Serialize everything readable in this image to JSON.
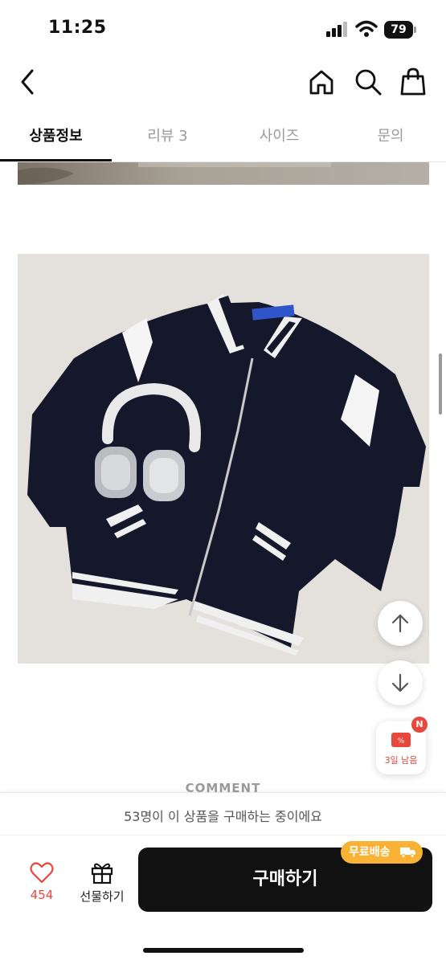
{
  "status_bar": {
    "time": "11:25",
    "battery": "79"
  },
  "header": {
    "icons": [
      "back-icon",
      "home-icon",
      "search-icon",
      "shopping-bag-icon"
    ]
  },
  "tabs": [
    {
      "label": "상품정보",
      "active": true
    },
    {
      "label": "리뷰 3",
      "active": false
    },
    {
      "label": "사이즈",
      "active": false
    },
    {
      "label": "문의",
      "active": false
    }
  ],
  "content": {
    "comment_heading": "COMMENT"
  },
  "floating": {
    "coupon_label": "3일 남음",
    "coupon_badge": "N"
  },
  "bottom_bar": {
    "buyers_text": "53명이 이 상품을 구매하는 중이에요",
    "like_count": "454",
    "gift_label": "선물하기",
    "buy_label": "구매하기",
    "free_shipping": "무료배송"
  },
  "colors": {
    "accent_red": "#e8483c",
    "buy_button": "#111111",
    "free_shipping_badge": "#f9b233"
  }
}
